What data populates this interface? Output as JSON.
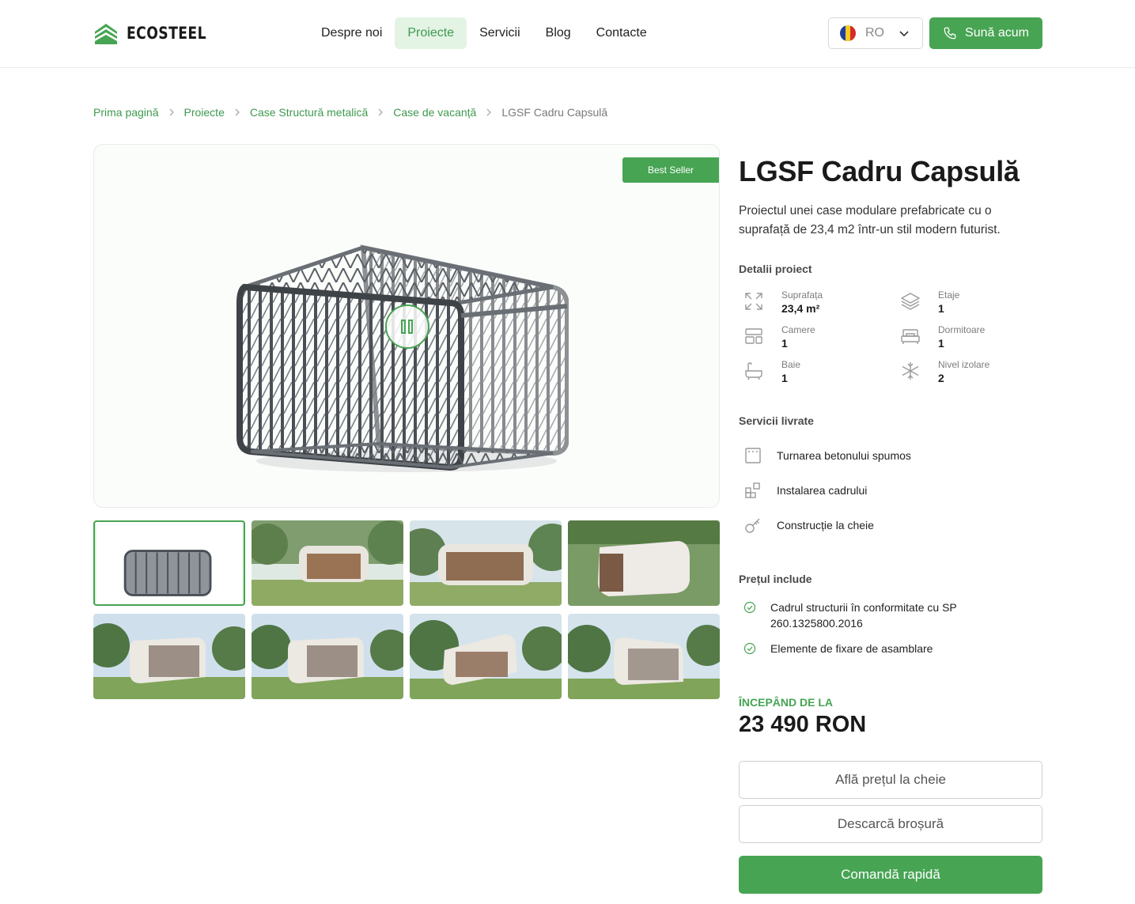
{
  "header": {
    "logo_text": "ECOSTEEL",
    "nav": [
      "Despre noi",
      "Proiecte",
      "Servicii",
      "Blog",
      "Contacte"
    ],
    "active_nav": "Proiecte",
    "language": "RO",
    "call_label": "Sună acum"
  },
  "breadcrumb": [
    "Prima pagină",
    "Proiecte",
    "Case Structură metalică",
    "Case de vacanță",
    "LGSF Cadru Capsulă"
  ],
  "gallery": {
    "badge": "Best Seller",
    "thumb_count": 8,
    "selected_thumb": 1
  },
  "product": {
    "title": "LGSF Cadru Capsulă",
    "description": "Proiectul unei case modulare prefabricate cu o suprafață de 23,4 m2 într-un stil modern futurist.",
    "details_title": "Detalii proiect",
    "details": [
      {
        "label": "Suprafața",
        "value": "23,4 m²",
        "icon": "expand-icon"
      },
      {
        "label": "Etaje",
        "value": "1",
        "icon": "layers-icon"
      },
      {
        "label": "Camere",
        "value": "1",
        "icon": "rooms-icon"
      },
      {
        "label": "Dormitoare",
        "value": "1",
        "icon": "bed-icon"
      },
      {
        "label": "Baie",
        "value": "1",
        "icon": "bathtub-icon"
      },
      {
        "label": "Nivel izolare",
        "value": "2",
        "icon": "snowflake-icon"
      }
    ],
    "services_title": "Servicii livrate",
    "services": [
      "Turnarea betonului spumos",
      "Instalarea cadrului",
      "Construcție la cheie"
    ],
    "includes_title": "Prețul include",
    "includes": [
      "Cadrul structurii în conformitate cu SP 260.1325800.2016",
      "Elemente de fixare de asamblare"
    ],
    "price_label": "ÎNCEPÂND DE LA",
    "price": "23 490 RON",
    "btn_turnkey": "Află prețul la cheie",
    "btn_brochure": "Descarcă broșură",
    "btn_order": "Comandă rapidă"
  },
  "colors": {
    "accent": "#47a453",
    "accent_light": "#e3f3e4"
  }
}
